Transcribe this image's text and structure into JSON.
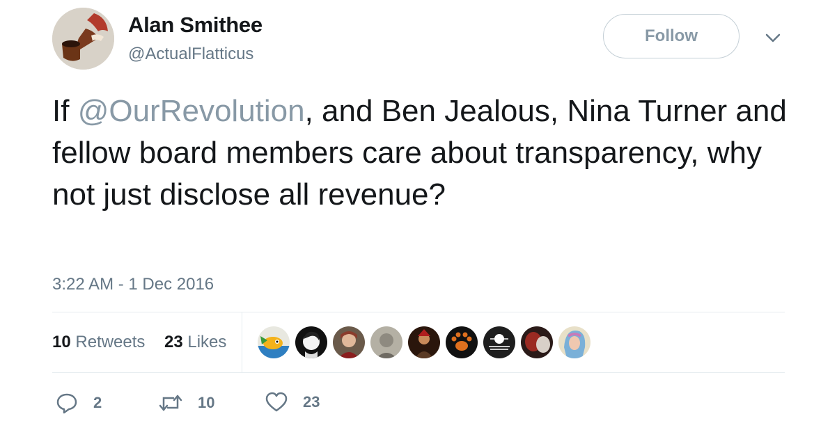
{
  "user": {
    "name": "Alan Smithee",
    "handle": "@ActualFlatticus",
    "avatar_icon": "pipe-avatar"
  },
  "follow_label": "Follow",
  "more_icon": "chevron-down-icon",
  "tweet": {
    "prefix": "If ",
    "mention": "@OurRevolution",
    "body": ", and Ben Jealous, Nina Turner and fellow board members care about transparency, why not just disclose all revenue?"
  },
  "timestamp": "3:22 AM - 1 Dec 2016",
  "stats": {
    "retweets_count": "10",
    "retweets_label": "Retweets",
    "likes_count": "23",
    "likes_label": "Likes"
  },
  "likers": [
    {
      "icon": "fish-cartoon-avatar",
      "color": "#2f7fc1"
    },
    {
      "icon": "portrait-sketch-avatar",
      "color": "#1a1a1a"
    },
    {
      "icon": "woman-photo-avatar",
      "color": "#8a4b3c"
    },
    {
      "icon": "grey-portrait-avatar",
      "color": "#9a9a8c"
    },
    {
      "icon": "painted-figure-avatar",
      "color": "#4a2a1c"
    },
    {
      "icon": "paw-avatar",
      "color": "#111111"
    },
    {
      "icon": "peoples-party-logo-avatar",
      "color": "#222222"
    },
    {
      "icon": "dark-red-avatar",
      "color": "#6b2a22"
    },
    {
      "icon": "colorful-hair-avatar",
      "color": "#b7a7c9"
    }
  ],
  "actions": {
    "reply_count": "2",
    "retweet_count": "10",
    "like_count": "23"
  },
  "colors": {
    "text": "#14171a",
    "secondary": "#657786",
    "mention": "#8899a6",
    "divider": "#e6ecf0"
  }
}
